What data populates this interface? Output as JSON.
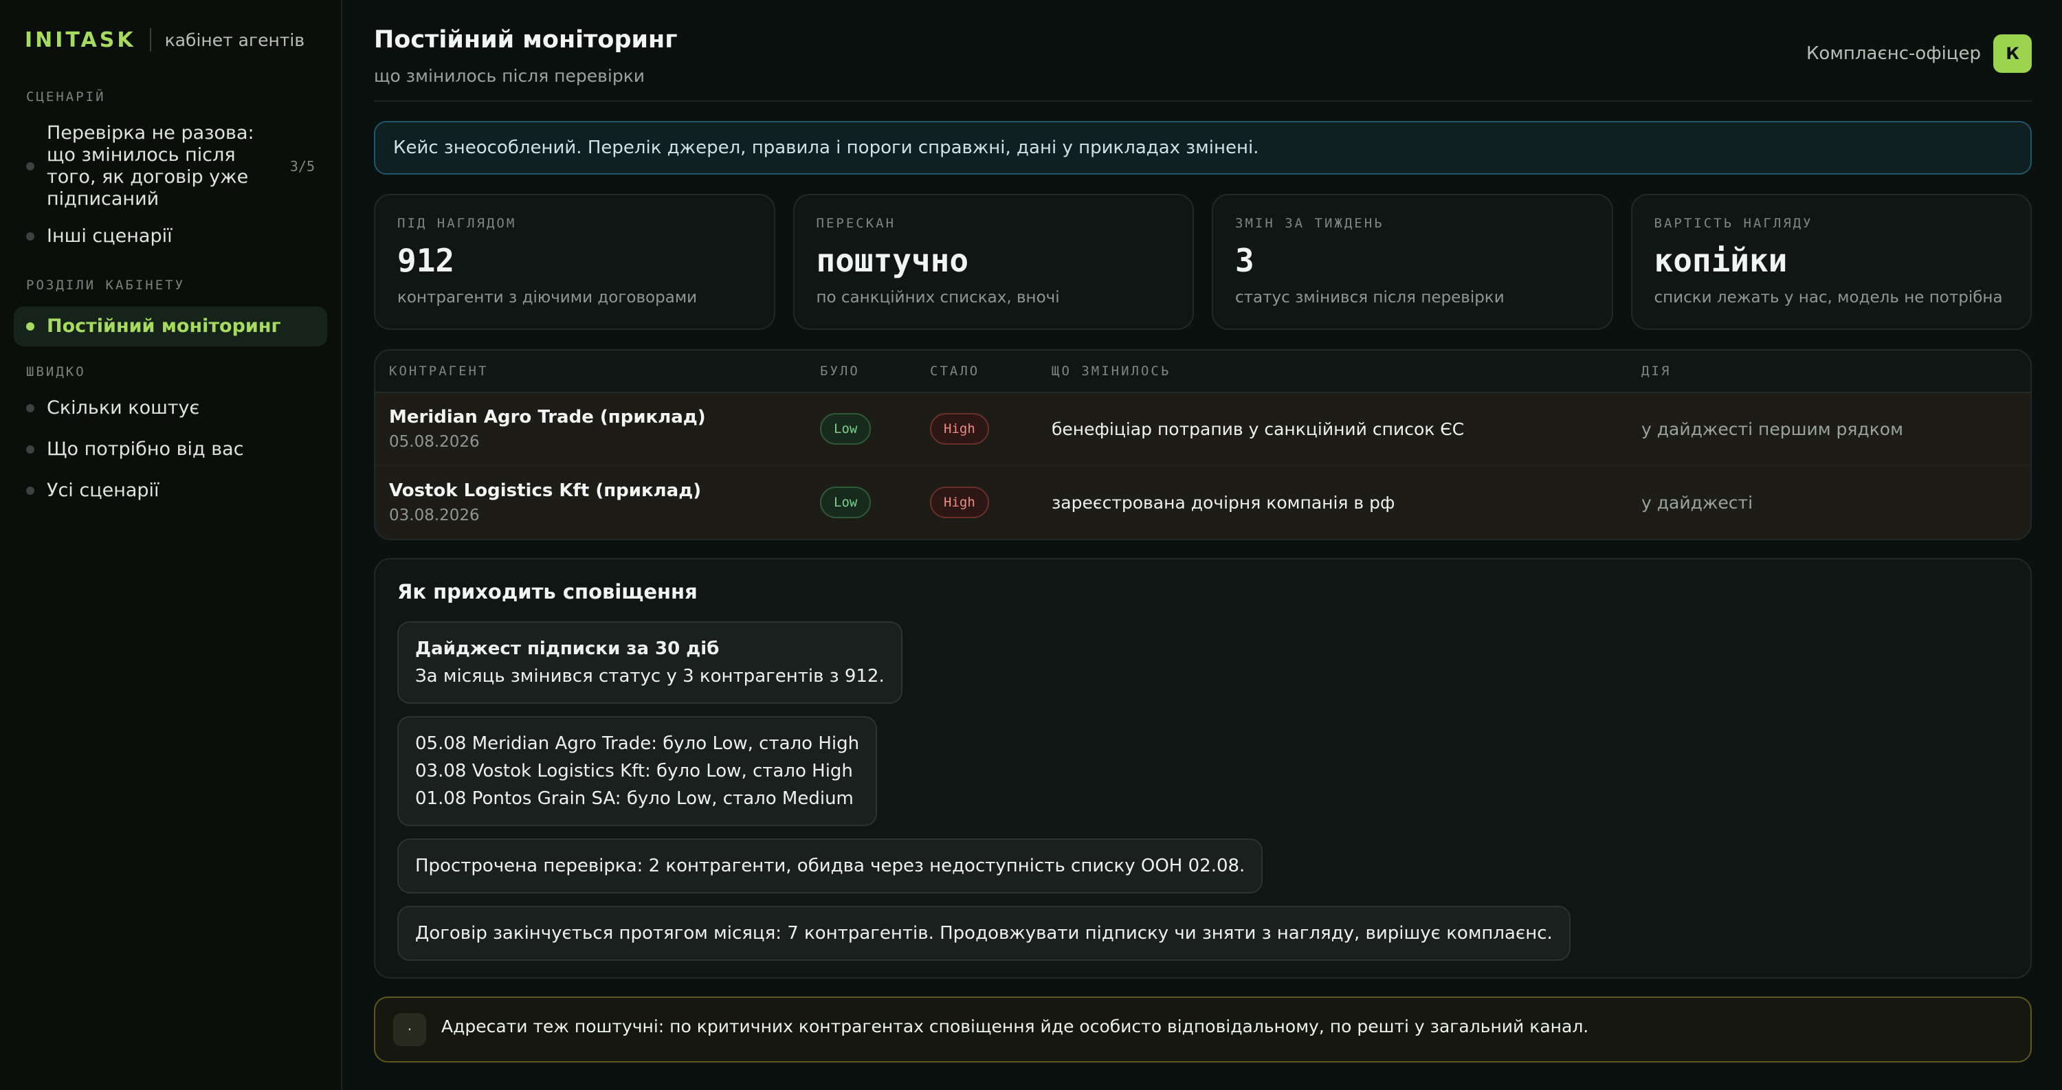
{
  "brand": {
    "logo": "INITASK",
    "subtitle": "кабінет агентів"
  },
  "sidebar": {
    "sections": [
      {
        "title": "СЦЕНАРІЙ",
        "items": [
          {
            "label": "Перевірка не разова: що змінилось після того, як договір уже підписаний",
            "count": "3/5"
          },
          {
            "label": "Інші сценарії"
          }
        ]
      },
      {
        "title": "РОЗДІЛИ КАБІНЕТУ",
        "items": [
          {
            "label": "Постійний моніторинг",
            "active": true
          }
        ]
      },
      {
        "title": "ШВИДКО",
        "items": [
          {
            "label": "Скільки коштує"
          },
          {
            "label": "Що потрібно від вас"
          },
          {
            "label": "Усі сценарії"
          }
        ]
      }
    ]
  },
  "header": {
    "title": "Постійний моніторинг",
    "subtitle": "що змінилось після перевірки",
    "user_role": "Комплаєнс-офіцер",
    "avatar_letter": "К"
  },
  "notice": "Кейс знеособлений. Перелік джерел, правила і пороги справжні, дані у прикладах змінені.",
  "stats": [
    {
      "label": "ПІД НАГЛЯДОМ",
      "value": "912",
      "desc": "контрагенти з діючими договорами"
    },
    {
      "label": "ПЕРЕСКАН",
      "value": "поштучно",
      "desc": "по санкційних списках, вночі"
    },
    {
      "label": "ЗМІН ЗА ТИЖДЕНЬ",
      "value": "3",
      "desc": "статус змінився після перевірки"
    },
    {
      "label": "ВАРТІСТЬ НАГЛЯДУ",
      "value": "копійки",
      "desc": "списки лежать у нас, модель не потрібна"
    }
  ],
  "table": {
    "headers": [
      "КОНТРАГЕНТ",
      "БУЛО",
      "СТАЛО",
      "ЩО ЗМІНИЛОСЬ",
      "ДІЯ"
    ],
    "rows": [
      {
        "company": "Meridian Agro Trade (приклад)",
        "date": "05.08.2026",
        "was": "Low",
        "now": "High",
        "change": "бенефіціар потрапив у санкційний список ЄС",
        "action": "у дайджесті першим рядком"
      },
      {
        "company": "Vostok Logistics Kft (приклад)",
        "date": "03.08.2026",
        "was": "Low",
        "now": "High",
        "change": "зареєстрована дочірня компанія в рф",
        "action": "у дайджесті"
      }
    ]
  },
  "notification": {
    "title": "Як приходить сповіщення",
    "digest_title": "Дайджест підписки за 30 діб",
    "digest_text": "За місяць змінився статус у 3 контрагентів з 912.",
    "changes": [
      "05.08 Meridian Agro Trade: було Low, стало High",
      "03.08 Vostok Logistics Kft: було Low, стало High",
      "01.08 Pontos Grain SA: було Low, стало Medium"
    ],
    "overdue": "Прострочена перевірка: 2 контрагенти, обидва через недоступність списку ООН 02.08.",
    "expiring": "Договір закінчується протягом місяця: 7 контрагентів. Продовжувати підписку чи зняти з нагляду, вирішує комплаєнс."
  },
  "footer_note": {
    "icon": "·",
    "text": "Адресати теж поштучні: по критичних контрагентах сповіщення йде особисто відповідальному, по решті у загальний канал."
  }
}
